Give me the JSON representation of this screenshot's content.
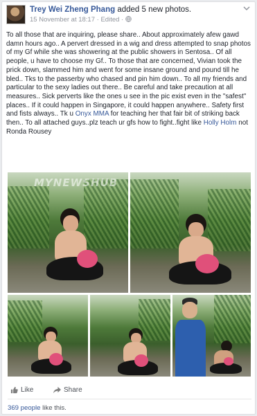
{
  "post": {
    "author": "Trey Wei Zheng Phang",
    "action": " added 5 new photos.",
    "date": "15 November at 18:17",
    "sep": " · ",
    "edited": "Edited",
    "edited_sep": " · ",
    "text_parts": [
      {
        "t": "To all those that are inquiring, please share.. About approximately afew gawd damn hours ago.. A pervert dressed in a wig and dress attempted to snap photos of my Gf while she was showering at the public showers in Sentosa.. Of all people, u have to choose my Gf.. To those that are concerned, Vivian took the prick down, slammed him and went for some insane ground and pound till he bled.. Tks to the passerby who chased and pin him down.. To all my friends and particular to the sexy ladies out there.. Be careful and take precaution at all measures.. Sick perverts like the ones u see in the pic exist even in the \"safest\" places.. If it could happen in Singapore, it could happen anywhere.. Safety first and fists always.. Tk u ",
        "link": false
      },
      {
        "t": "Onyx MMA",
        "link": true
      },
      {
        "t": " for teaching her that fair bit of striking back then.. To all attached guys..plz teach ur gfs how to fight..fight like ",
        "link": false
      },
      {
        "t": "Holly Holm",
        "link": true
      },
      {
        "t": " not Ronda Rousey",
        "link": false
      }
    ],
    "watermark": "MYNEWSHUB"
  },
  "actions": {
    "like": "Like",
    "share": "Share"
  },
  "likes": {
    "count_link": "369 people",
    "suffix": " like this."
  },
  "icons": {
    "caret": "chevron-down-icon",
    "like": "thumbs-up-icon",
    "share": "share-arrow-icon",
    "globe": "globe-icon"
  },
  "colors": {
    "link": "#365899",
    "meta": "#90949c",
    "accent_bag": "#e0507a",
    "guard_uniform": "#2d5fae"
  }
}
